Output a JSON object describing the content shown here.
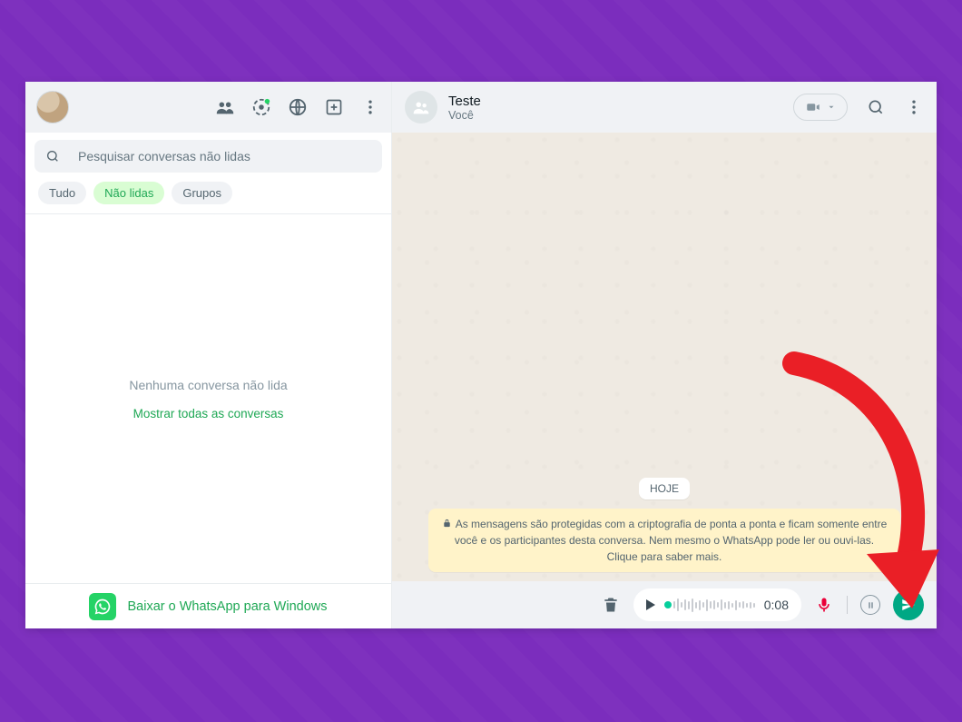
{
  "sidebar": {
    "search_placeholder": "Pesquisar conversas não lidas",
    "filters": {
      "all": "Tudo",
      "unread": "Não lidas",
      "unread_active": true,
      "groups": "Grupos"
    },
    "empty_message": "Nenhuma conversa não lida",
    "show_all_link": "Mostrar todas as conversas",
    "download_label": "Baixar o WhatsApp para Windows"
  },
  "sidebar_icons": {
    "communities": "communities-icon",
    "status": "status-icon",
    "channels": "channels-icon",
    "new_chat": "new-chat-icon",
    "menu": "menu-icon"
  },
  "chat": {
    "title": "Teste",
    "subtitle": "Você",
    "date_label": "HOJE",
    "encryption_notice": "As mensagens são protegidas com a criptografia de ponta a ponta e ficam somente entre você e os participantes desta conversa. Nem mesmo o WhatsApp pode ler ou ouvi-las. Clique para saber mais."
  },
  "recording": {
    "duration": "0:08"
  },
  "colors": {
    "accent": "#00a884",
    "whatsapp_green": "#25d366",
    "mic_red": "#ea0038",
    "callout_red": "#ea1f26",
    "bg_purple": "#7b2dbd"
  }
}
